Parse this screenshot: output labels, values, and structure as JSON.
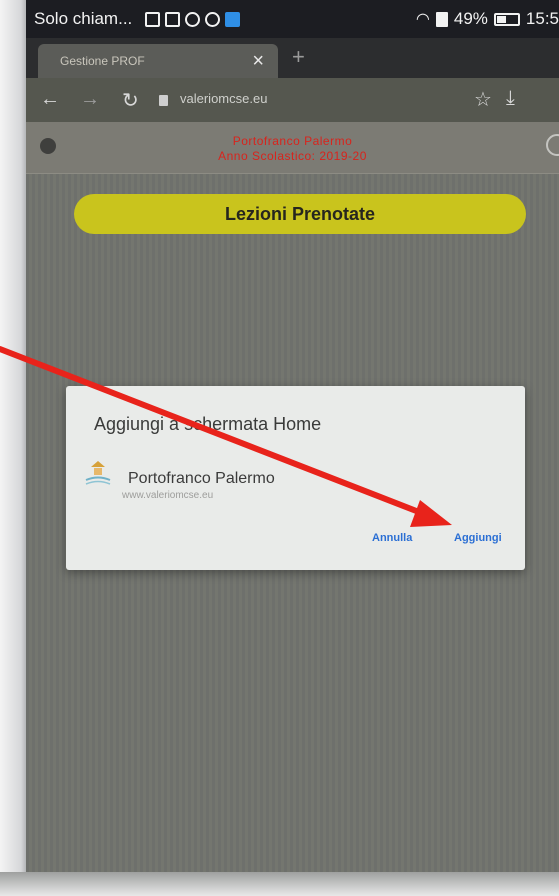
{
  "status_bar": {
    "carrier": "Solo chiam...",
    "battery": "49%",
    "time": "15:5"
  },
  "browser": {
    "tab_title": "Gestione PROF",
    "tab_close": "×",
    "new_tab": "+",
    "url": "valeriomcse.eu"
  },
  "app_header": {
    "title": "Portofranco Palermo",
    "subtitle": "Anno Scolastico: 2019-20"
  },
  "page": {
    "heading": "Lezioni Prenotate"
  },
  "dialog": {
    "title": "Aggiungi a schermata Home",
    "app_name": "Portofranco Palermo",
    "app_url": "www.valeriomcse.eu",
    "cancel_label": "Annulla",
    "add_label": "Aggiungi"
  },
  "annotation": {
    "arrow_color": "#e8231b",
    "points_to": "add-button"
  },
  "colors": {
    "header_title": "#d8241d",
    "pill": "#c9c41d",
    "dialog_button": "#2b6fd4"
  }
}
